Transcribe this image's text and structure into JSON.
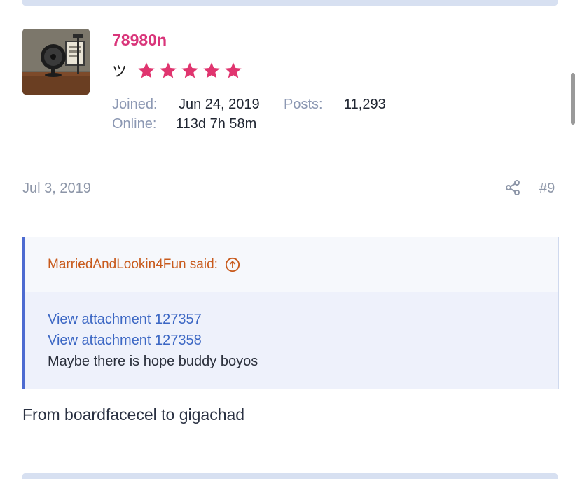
{
  "user": {
    "name": "78980n",
    "title": "ツ",
    "rating_stars": 5,
    "joined_label": "Joined:",
    "joined_value": "Jun 24, 2019",
    "posts_label": "Posts:",
    "posts_value": "11,293",
    "online_label": "Online:",
    "online_value": "113d 7h 58m",
    "name_color": "#d9357a",
    "star_color": "#e0356f"
  },
  "post": {
    "date": "Jul 3, 2019",
    "number": "#9",
    "share_icon": "share-icon",
    "body": "From boardfacecel to gigachad"
  },
  "quote": {
    "author": "MarriedAndLookin4Fun said:",
    "arrow_icon": "arrow-up-circle-icon",
    "links": [
      "View attachment 127357",
      "View attachment 127358"
    ],
    "text": "Maybe there is hope buddy boyos",
    "accent_color": "#4d6bd1",
    "author_color": "#c85a1c"
  }
}
